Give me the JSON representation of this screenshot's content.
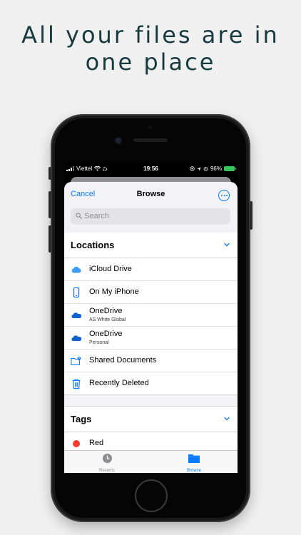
{
  "headline": {
    "line1": "All your files are in",
    "line2": "one place"
  },
  "status_bar": {
    "carrier": "Viettel",
    "time": "19:56",
    "battery": "96%"
  },
  "nav": {
    "cancel_label": "Cancel",
    "title": "Browse",
    "more_icon": "ellipsis-circle-icon"
  },
  "search": {
    "placeholder": "Search"
  },
  "locations": {
    "header": "Locations",
    "items": [
      {
        "label": "iCloud Drive",
        "icon": "icloud-icon"
      },
      {
        "label": "On My iPhone",
        "icon": "iphone-icon"
      },
      {
        "label": "OneDrive",
        "sublabel": "AS White Global",
        "icon": "onedrive-icon"
      },
      {
        "label": "OneDrive",
        "sublabel": "Personal",
        "icon": "onedrive-icon"
      },
      {
        "label": "Shared Documents",
        "icon": "shared-folder-icon"
      },
      {
        "label": "Recently Deleted",
        "icon": "trash-icon"
      }
    ]
  },
  "tags": {
    "header": "Tags",
    "items": [
      {
        "label": "Red",
        "color": "#ff3b30"
      }
    ]
  },
  "tabbar": {
    "tabs": [
      {
        "label": "Recents",
        "icon": "clock-icon",
        "active": false
      },
      {
        "label": "Browse",
        "icon": "folder-icon",
        "active": true
      }
    ]
  },
  "colors": {
    "accent": "#0a7aff",
    "headline": "#173a3e",
    "background": "#f0f0f0"
  }
}
